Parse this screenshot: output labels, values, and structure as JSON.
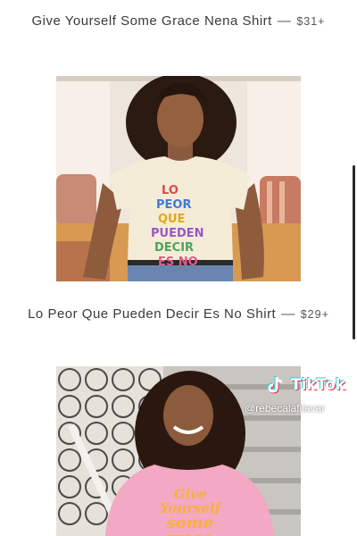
{
  "products": [
    {
      "title": "Give Yourself Some Grace Nena Shirt",
      "separator": "—",
      "price": "$31+",
      "shirt_print": [
        "Give",
        "Yourself",
        "some",
        "grace,"
      ]
    },
    {
      "title": "Lo Peor Que Pueden Decir Es No Shirt",
      "separator": "—",
      "price": "$29+",
      "shirt_print": [
        "LO",
        "PEOR",
        "QUE",
        "PUEDEN",
        "DECIR",
        "ES NO"
      ]
    }
  ],
  "overlay": {
    "brand": "TikTok",
    "handle": "@rebecalafilavar"
  },
  "colors": {
    "tiktok_red": "#e0334a",
    "tiktok_cyan": "#2bd3d8",
    "sweater_pink": "#f3a8c4",
    "tee_cream": "#f5ecd8"
  },
  "icons": [
    "tiktok-logo-icon"
  ]
}
